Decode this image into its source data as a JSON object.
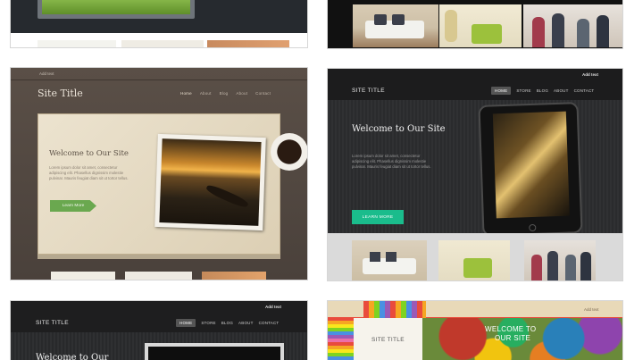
{
  "templates": [
    {
      "id": "brown-vintage",
      "top_link": "Add text",
      "site_title": "Site Title",
      "nav": [
        "Home",
        "About",
        "Blog",
        "About",
        "Contact"
      ],
      "heading": "Welcome to Our Site",
      "body": "Lorem ipsum dolor sit amet, consectetur adipiscing elit. Phasellus dignissim molestie pulvinar. Mauris feugiat diam sit ut tortor tellus.",
      "button": "Learn More"
    },
    {
      "id": "dark-tablet",
      "top_link": "Add text",
      "site_title": "SITE TITLE",
      "nav": [
        "HOME",
        "STORE",
        "BLOG",
        "ABOUT",
        "CONTACT"
      ],
      "heading": "Welcome to Our Site",
      "body": "Lorem ipsum dolor sit amet, consectetur adipiscing elit. Phasellus dignissim molestie pulvinar. Mauris feugiat diam sit ut tortor tellus.",
      "button": "LEARN MORE"
    },
    {
      "id": "dark-bottom",
      "top_link": "Add text",
      "site_title": "SITE TITLE",
      "nav": [
        "HOME",
        "STORE",
        "BLOG",
        "ABOUT",
        "CONTACT"
      ],
      "heading": "Welcome to Our"
    },
    {
      "id": "colorful-pencils",
      "top_link": "Add text",
      "site_title": "SITE TITLE",
      "heading_line1": "WELCOME TO",
      "heading_line2": "OUR SITE"
    }
  ],
  "colors": {
    "green_button": "#6aa84f",
    "teal_button": "#1abc8c"
  }
}
